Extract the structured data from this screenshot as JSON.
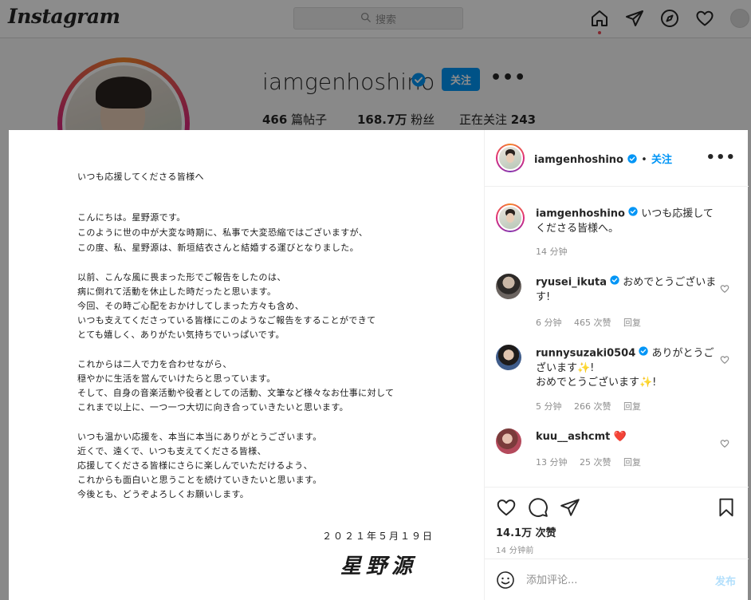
{
  "nav": {
    "logo": "Instagram",
    "search_placeholder": "搜索"
  },
  "profile": {
    "username": "iamgenhoshino",
    "follow_label": "关注",
    "more": "•••",
    "stats": [
      {
        "value": "466",
        "label": "篇帖子"
      },
      {
        "value": "168.7万",
        "label": "粉丝"
      },
      {
        "value": "243",
        "label": "正在关注",
        "prefix_label": true
      }
    ]
  },
  "post": {
    "letter_greeting": "いつも応援してくださる皆様へ",
    "letter_lines": [
      "こんにちは。星野源です。",
      "このように世の中が大変な時期に、私事で大変恐縮ではございますが、",
      "この度、私、星野源は、新垣結衣さんと結婚する運びとなりました。",
      "以前、こんな風に畏まった形でご報告をしたのは、",
      "病に倒れて活動を休止した時だったと思います。",
      "今回、その時ご心配をおかけしてしまった方々も含め、",
      "いつも支えてくださっている皆様にこのようなご報告をすることができて",
      "とても嬉しく、ありがたい気持ちでいっぱいです。",
      "これからは二人で力を合わせながら、",
      "穏やかに生活を営んでいけたらと思っています。",
      "そして、自身の音楽活動や役者としての活動、文筆など様々なお仕事に対して",
      "これまで以上に、一つ一つ大切に向き合っていきたいと思います。",
      "いつも温かい応援を、本当に本当にありがとうございます。",
      "近くで、遠くで、いつも支えてくださる皆様、",
      "応援してくださる皆様にさらに楽しんでいただけるよう、",
      "これからも面白いと思うことを続けていきたいと思います。",
      "今後とも、どうぞよろしくお願いします。"
    ],
    "letter_date": "２０２１年５月１９日",
    "letter_signature": "星野源"
  },
  "sidebar": {
    "header": {
      "username": "iamgenhoshino",
      "dot": "•",
      "follow_label": "关注",
      "more": "•••"
    },
    "caption": {
      "username": "iamgenhoshino",
      "text": "いつも応援してくださる皆様へ。",
      "time": "14 分钟"
    },
    "comments": [
      {
        "username": "ryusei_ikuta",
        "verified": true,
        "text": "おめでとうございます!",
        "time": "6 分钟",
        "likes": "465 次赞",
        "reply": "回复"
      },
      {
        "username": "runnysuzaki0504",
        "verified": true,
        "text": "ありがとうございます✨!",
        "text2": "おめでとうございます✨!",
        "time": "5 分钟",
        "likes": "266 次赞",
        "reply": "回复"
      },
      {
        "username": "kuu__ashcmt",
        "verified": false,
        "text": "❤️",
        "time": "13 分钟",
        "likes": "25 次赞",
        "reply": "回复"
      }
    ],
    "likes": "14.1万 次赞",
    "posted": "14 分钟前",
    "comment_placeholder": "添加评论...",
    "publish_label": "发布"
  },
  "colors": {
    "accent": "#0095f6",
    "like_red": "#ed4956",
    "heart_red": "#e0245e"
  }
}
